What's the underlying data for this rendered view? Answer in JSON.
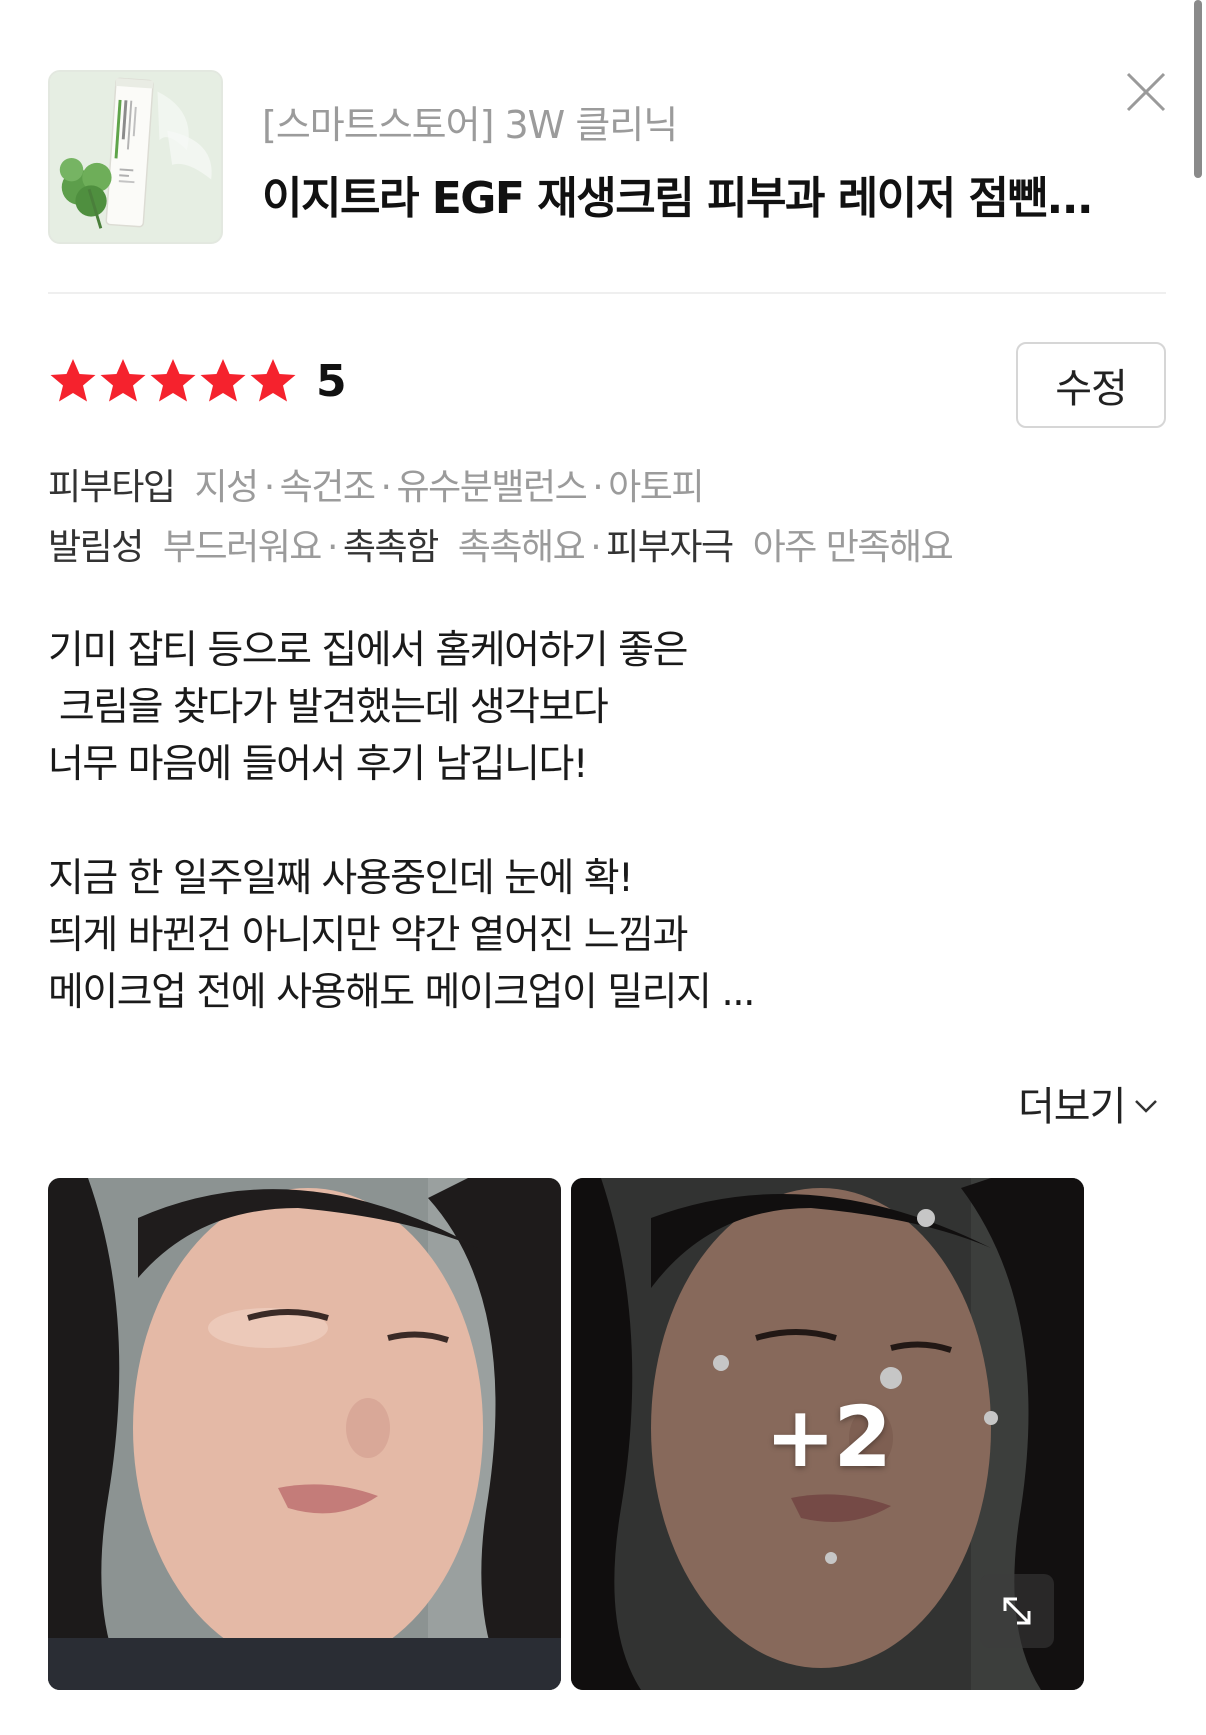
{
  "product": {
    "store": "[스마트스토어] 3W 클리닉",
    "name": "이지트라 EGF 재생크림 피부과 레이저 점뺀...",
    "thumbnail_icon": "cream-tube-image"
  },
  "rating": {
    "stars": 5,
    "max": 5,
    "score_label": "5",
    "star_color": "#f5222d"
  },
  "edit_button": {
    "label": "수정"
  },
  "attributes": {
    "row1": {
      "key": "피부타입",
      "values": [
        "지성",
        "속건조",
        "유수분밸런스",
        "아토피"
      ]
    },
    "row2": {
      "k1": "발림성",
      "v1": "부드러워요",
      "k2": "촉촉함",
      "v2": "촉촉해요",
      "k3": "피부자극",
      "v3": "아주 만족해요"
    }
  },
  "review": {
    "lines": [
      "기미 잡티 등으로 집에서 홈케어하기 좋은",
      " 크림을 찾다가 발견했는데 생각보다",
      "너무 마음에 들어서 후기 남깁니다!",
      "",
      "지금 한 일주일째 사용중인데 눈에 확!",
      "띄게 바뀐건 아니지만 약간 옅어진 느낌과",
      "메이크업 전에 사용해도 메이크업이 밀리지 ..."
    ]
  },
  "more_button": {
    "label": "더보기",
    "icon": "chevron-down-icon"
  },
  "photos": {
    "extra_count_label": "+2",
    "expand_icon": "expand-icon"
  }
}
